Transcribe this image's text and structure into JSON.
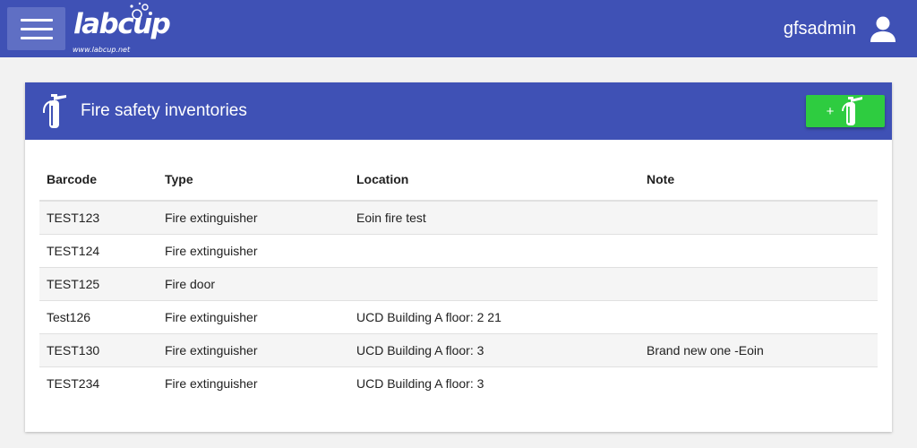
{
  "app": {
    "logo_text": "labcup",
    "logo_url": "www.labcup.net",
    "username": "gfsadmin"
  },
  "icons": {
    "menu": "hamburger-menu-icon",
    "user": "user-icon",
    "fire_extinguisher": "fire-extinguisher-icon"
  },
  "colors": {
    "primary": "#3f51b5",
    "menu_button": "#5f6fc4",
    "add_button": "#2ecc40"
  },
  "card": {
    "title": "Fire safety inventories",
    "add_button_label": "+"
  },
  "table": {
    "columns": [
      "Barcode",
      "Type",
      "Location",
      "Note"
    ],
    "rows": [
      {
        "barcode": "TEST123",
        "type": "Fire extinguisher",
        "location": "Eoin fire test",
        "note": ""
      },
      {
        "barcode": "TEST124",
        "type": "Fire extinguisher",
        "location": "",
        "note": ""
      },
      {
        "barcode": "TEST125",
        "type": "Fire door",
        "location": "",
        "note": ""
      },
      {
        "barcode": "Test126",
        "type": "Fire extinguisher",
        "location": "UCD Building A floor: 2 21",
        "note": ""
      },
      {
        "barcode": "TEST130",
        "type": "Fire extinguisher",
        "location": "UCD Building A floor: 3",
        "note": "Brand new one -Eoin"
      },
      {
        "barcode": "TEST234",
        "type": "Fire extinguisher",
        "location": "UCD Building A floor: 3",
        "note": ""
      }
    ]
  }
}
